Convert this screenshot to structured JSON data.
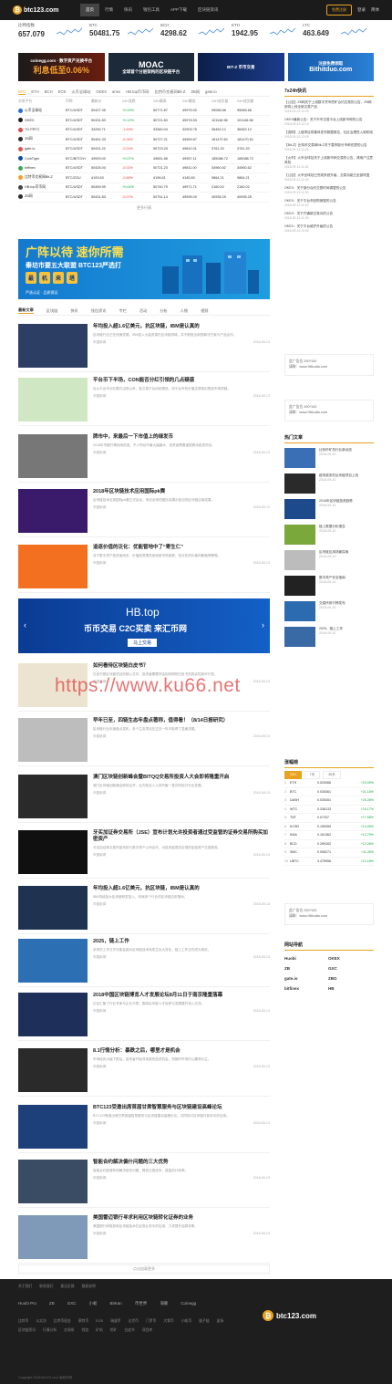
{
  "header": {
    "logo": "btc123.com",
    "nav": [
      "首页",
      "行情",
      "快讯",
      "钱包工具",
      "APP下载",
      "区块链资讯"
    ],
    "active_index": 0,
    "register": "免费注册",
    "login": "登录",
    "lang": "简体"
  },
  "ticker": [
    {
      "name": "比特指数",
      "value": "657.079"
    },
    {
      "name": "BTC",
      "value": "50481.75"
    },
    {
      "name": "BCH",
      "value": "4298.62"
    },
    {
      "name": "ETH",
      "value": "1942.95"
    },
    {
      "name": "LTC",
      "value": "463.649"
    }
  ],
  "banners": [
    {
      "title": "coinegg.com · 数字资产兑换平台",
      "big": "利息低至0.06%"
    },
    {
      "title": "MOAC",
      "big": "MOAC",
      "sub": "全球首个分层架构的区块链平台"
    },
    {
      "title": "BIT-Z 币币交易"
    },
    {
      "title": "注册免费领取",
      "big": "Bithitduo.com"
    }
  ],
  "market": {
    "tabs": [
      "BTC",
      "ETH",
      "BCH",
      "EOS",
      "火币全球站",
      "OKEX",
      "anex",
      "HB.top币币网",
      "比特币交易网Bit-Z",
      "ZB网",
      "gate.io"
    ],
    "active_tab": 0,
    "headers": [
      "交易平台",
      "币种",
      "最新价",
      "24H涨跌",
      "24H最高",
      "24H最低",
      "24H成交量",
      "24H成交额"
    ],
    "rows": [
      {
        "ex": "火币全球站",
        "pair": "BTC/USDT",
        "price": "50427.35",
        "chg": "+0.00%",
        "high": "50771.87",
        "low": "49975.00",
        "vol": "95066.66",
        "amt": "95066.66"
      },
      {
        "ex": "OKEX",
        "pair": "BTC/USDT",
        "price": "50431.83",
        "chg": "+0.12%",
        "high": "50721.60",
        "low": "49978.53",
        "vol": "101146.58",
        "amt": "101146.58"
      },
      {
        "ex": "TO.PRTC",
        "pair": "BTC/USDT",
        "price": "33250.71",
        "chg": "-1.69%",
        "high": "33360.04",
        "low": "32903.75",
        "vol": "36452.12",
        "amt": "36452.12"
      },
      {
        "ex": "ZB网",
        "pair": "BTC/USDT",
        "price": "50461.33",
        "chg": "-0.06%",
        "high": "50727.21",
        "low": "49969.67",
        "vol": "181470.61",
        "amt": "181470.61"
      },
      {
        "ex": "gate.io",
        "pair": "BTC/USDT",
        "price": "50431.22",
        "chg": "-0.04%",
        "high": "50723.29",
        "low": "49810.01",
        "vol": "3761.20",
        "amt": "3761.20"
      },
      {
        "ex": "CoinTiger",
        "pair": "BTC/BITCNY",
        "price": "49593.00",
        "chg": "+0.07%",
        "high": "49651.88",
        "low": "49957.11",
        "vol": "185088.72",
        "amt": "185088.72"
      },
      {
        "ex": "bitfinex",
        "pair": "BTC/USDT",
        "price": "50426.00",
        "chg": "-0.02%",
        "high": "50721.23",
        "low": "49811.00",
        "vol": "34960.62",
        "amt": "34960.62"
      },
      {
        "ex": "比特币交易网Bit-Z",
        "pair": "BTC/ZGU",
        "price": "4193.63",
        "chg": "-0.68%",
        "high": "4196.61",
        "low": "4145.60",
        "vol": "9864.21",
        "amt": "9864.21"
      },
      {
        "ex": "HB.top币币网",
        "pair": "BTC/USDT",
        "price": "50459.99",
        "chg": "+0.04%",
        "high": "50740.79",
        "low": "49971.71",
        "vol": "2160.02",
        "amt": "2160.02"
      },
      {
        "ex": "ZB网",
        "pair": "BTC/USDT",
        "price": "50431.83",
        "chg": "-0.07%",
        "high": "50751.14",
        "low": "49995.00",
        "vol": "40935.25",
        "amt": "40935.25"
      }
    ],
    "more": "更多行情"
  },
  "ad_big": {
    "t1": "广阵以待 速你所需",
    "t2": "秦坊市要五大联盟 BTC123严选打",
    "chips": [
      "最",
      "机",
      "来",
      "塔"
    ],
    "tag": "严选认证 · 品质保证"
  },
  "news_tabs": [
    "最新文章",
    "区块链",
    "快讯",
    "钱包资讯",
    "专栏",
    "活动",
    "分析",
    "人物",
    "视频"
  ],
  "news_active": 0,
  "articles": [
    {
      "title": "年均投入超1.6亿美元，抗区块链，IBM是认真的",
      "summary": "区块链行业正在快速发展，IBM投入大量资源在区块链领域，并不断推出新的解决方案与产品合作。",
      "meta": "币圈新闻",
      "time": "2018-09-13"
    },
    {
      "title": "平台币下半场，CON能否分红引领的几点疑惑",
      "summary": "自从平台币分红模式出现以来，各交易平台纷纷跟进，但平台币的价值支撑依旧受到市场质疑。",
      "meta": "币圈新闻",
      "time": "2018-09-13"
    },
    {
      "title": "牌市中，来最后一下市值上的绿发币",
      "summary": "2018年币圈行情持续低迷，不少项目市值大幅缩水，投资者需要谨慎看待各类项目。",
      "meta": "币圈新闻",
      "time": "2018-09-13"
    },
    {
      "title": "2018年区块链技术应用国际pk赛",
      "summary": "区块链技术应用国际pk赛正式启动，来自全球的团队将展示各自的区块链应用成果。",
      "meta": "币圈新闻",
      "time": "2018-09-13"
    },
    {
      "title": "追逐价值的泛化：优能管地中了“寄生仁”",
      "summary": "对于数字资产投资者而言，价值投资理念逐渐被市场接受，但泛化的价值判断值得警惕。",
      "meta": "币圈新闻",
      "time": "2018-09-13"
    },
    {
      "title": "如何看待区块链白皮书？",
      "summary": "白皮书是区块链项目的核心文件，投资者需要学会如何辨别白皮书的真实性和可行性。",
      "meta": "币圈新闻",
      "time": "2018-09-13"
    },
    {
      "title": "早年已至，四链生态年盘点著称，值得看！（8/14日报研究）",
      "summary": "区块链行业年度盘点发布，多个生态项目在过去一年中取得了显著进展。",
      "meta": "币圈新闻",
      "time": "2018-09-13"
    },
    {
      "title": "澳门区块链创新峰会暨BITQQ交易所投资人大会即将隆重开启",
      "summary": "澳门区块链创新峰会即将召开，业内知名人士将齐聚一堂共同探讨行业发展。",
      "meta": "币圈新闻",
      "time": "2018-09-13"
    },
    {
      "title": "牙买加证券交易所（JSE）宣布计划允许投资者通过受监管的证券交易所购买加密资产",
      "summary": "牙买加证券交易所宣布将与数字资产公司合作，为投资者提供合规的加密资产交易服务。",
      "meta": "币圈新闻",
      "time": "2018-09-13"
    },
    {
      "title": "年均投入超1.6亿美元，抗区块链，IBM是认真的",
      "summary": "IBM持续加大区块链研发投入，布局多个行业的区块链应用落地。",
      "meta": "币圈新闻",
      "time": "2018-09-13"
    },
    {
      "title": "2025，链上工作",
      "summary": "未来的工作方式可能会因为区块链技术而发生巨大变化，链上工作正在成为现实。",
      "meta": "币圈新闻",
      "time": "2018-09-13"
    },
    {
      "title": "2018中国区块链博览人才发展论坛8月11日于南京隆重落幕",
      "summary": "论坛汇聚了行业专家与企业代表，围绕区块链人才培养与发展展开深入交流。",
      "meta": "币圈新闻",
      "time": "2018-09-13"
    },
    {
      "title": "8.1行情分析：暴跌之后，哪里才是机会",
      "summary": "市场经历大幅下跌后，投资者开始寻找新的投资机会，短期内市场仍以震荡为主。",
      "meta": "币圈新闻",
      "time": "2018-09-13"
    },
    {
      "title": "BTC123受邀出席首届甘肃智慧服务与区块链建设高峰论坛",
      "summary": "BTC123受邀出席甘肃首届智慧服务与区块链建设高峰论坛，共同探讨区块链在政务中的应用。",
      "meta": "币圈新闻",
      "time": "2018-09-13"
    },
    {
      "title": "智能合约解决偏什问题的三大优势",
      "summary": "智能合约能够有效解决信任问题，降低交易成本，提高执行效率。",
      "meta": "币圈新闻",
      "time": "2018-09-13"
    },
    {
      "title": "美国雷迈银行寻求利用区块链转化证券的业务",
      "summary": "美国银行积极探索区块链技术在证券业务中的应用，力求提升结算效率。",
      "meta": "币圈新闻",
      "time": "2018-09-13"
    }
  ],
  "hb_ad": {
    "t1": "HB.top",
    "t2": "币币交易  C2C买卖  来汇币网",
    "t3": "马上交易"
  },
  "load_more": "点击加载更多",
  "side": {
    "flash_title": "7x24h快讯",
    "flash": [
      {
        "text": "【公告】ZB网关于上线数字货币挖矿合约交易的公告，ZB网即将上线全新交易产品",
        "time": "2018-09-13 12:29"
      },
      {
        "text": "OKEX最新公告：关于币币交易平台上线新币种的公告",
        "time": "2018-09-13 12:14"
      },
      {
        "text": "【选购】上链项目将集体发布数据报告，社区治理进入新阶段",
        "time": "2018-09-13 12:09"
      },
      {
        "text": "【Bit-Z】比特币交易网Bit-Z关于暂停部分币种充提的公告",
        "time": "2018-09-13 12:01"
      },
      {
        "text": "【火币】火币全球站关于上线新币种交易的公告，请用户注意风险",
        "time": "2018-09-13 11:52"
      },
      {
        "text": "【公告】火币全球站已完成系统升级，交易功能已全部恢复",
        "time": "2018-09-13 11:46"
      },
      {
        "text": "OKEX：关于部分合约交割时间调整的公告",
        "time": "2018-09-13 11:30"
      },
      {
        "text": "OKEX：关于平台币回购销毁的公告",
        "time": "2018-09-13 11:20"
      },
      {
        "text": "OKEX：关于开通新交易对的公告",
        "time": "2018-09-13 11:05"
      },
      {
        "text": "OKEX：关于平台维护升级的公告",
        "time": "2018-09-13 10:52"
      }
    ],
    "ad1": {
      "line1": "此广告位 290*100",
      "line2": "请联：www.96kudia.com"
    },
    "ad2": {
      "line1": "此广告位 290*100",
      "line2": "请联：www.96kudia.com"
    },
    "hot_title": "热门文章",
    "hot": [
      {
        "text": "比特币矿机行业新动态",
        "time": "2018-09-10"
      },
      {
        "text": "越来越多的区块链项目上线",
        "time": "2018-09-10"
      },
      {
        "text": "2018年区块链投资趋势",
        "time": "2018-09-10"
      },
      {
        "text": "链上数据分析报告",
        "time": "2018-09-10"
      },
      {
        "text": "区块链应用场景探索",
        "time": "2018-09-10"
      },
      {
        "text": "数字资产安全指南",
        "time": "2018-09-10"
      },
      {
        "text": "交易所排行榜发布",
        "time": "2018-09-10"
      },
      {
        "text": "2025，链上工作",
        "time": "2018-09-10"
      }
    ],
    "rank_title": "涨幅榜",
    "rank_tabs": [
      "24H",
      "7天",
      "30天"
    ],
    "rank": [
      {
        "n": "1",
        "coin": "ETH",
        "price": "0.025366",
        "chg": "+23.09%"
      },
      {
        "n": "2",
        "coin": "BTC",
        "price": "0.035361",
        "chg": "+21.16%"
      },
      {
        "n": "3",
        "coin": "DASH",
        "price": "0.035451",
        "chg": "+20.26%"
      },
      {
        "n": "4",
        "coin": "WTC",
        "price": "0.336133",
        "chg": "+18.17%"
      },
      {
        "n": "5",
        "coin": "TNT",
        "price": "0.07337",
        "chg": "+17.58%"
      },
      {
        "n": "6",
        "coin": "KCSR",
        "price": "0.159359",
        "chg": "+14.05%"
      },
      {
        "n": "7",
        "coin": "KMA",
        "price": "0.161362",
        "chg": "+13.75%"
      },
      {
        "n": "8",
        "coin": "BCD",
        "price": "0.269162",
        "chg": "+12.26%"
      },
      {
        "n": "9",
        "coin": "SMC",
        "price": "0.055271",
        "chg": "+11.45%"
      },
      {
        "n": "10",
        "coin": "UBTC",
        "price": "3.475956",
        "chg": "+10.18%"
      }
    ],
    "ad3": {
      "line1": "此广告位 290*100",
      "line2": "请联：www.96kudia.com"
    },
    "links_title": "网站导航",
    "links": [
      "Huobi",
      "OKEX",
      "ZB",
      "GXC",
      "gate.io",
      "ZBG",
      "bitfinex",
      "HB"
    ]
  },
  "footer": {
    "row1": [
      "关于我们",
      "联系我们",
      "意见反馈",
      "版权说明"
    ],
    "partners": [
      "Huobi Pro",
      "ZB",
      "GXC",
      "小蚁",
      "BitKan",
      "币世界",
      "海豚",
      "Coinegg"
    ],
    "row3": [
      "比特币",
      "以太坊",
      "比特币现金",
      "莱特币",
      "EOS",
      "瑞波币",
      "达世币",
      "门罗币",
      "大零币",
      "小蚁币",
      "量子链",
      "波场"
    ],
    "row4": [
      "区块链资讯",
      "行情分析",
      "交易所",
      "钱包",
      "矿机",
      "挖矿",
      "白皮书",
      "项目库"
    ],
    "logo": "btc123.com",
    "copy": "Copyright 2018 btc123.com 版权所有"
  },
  "watermark": "https://www.ku66.net"
}
